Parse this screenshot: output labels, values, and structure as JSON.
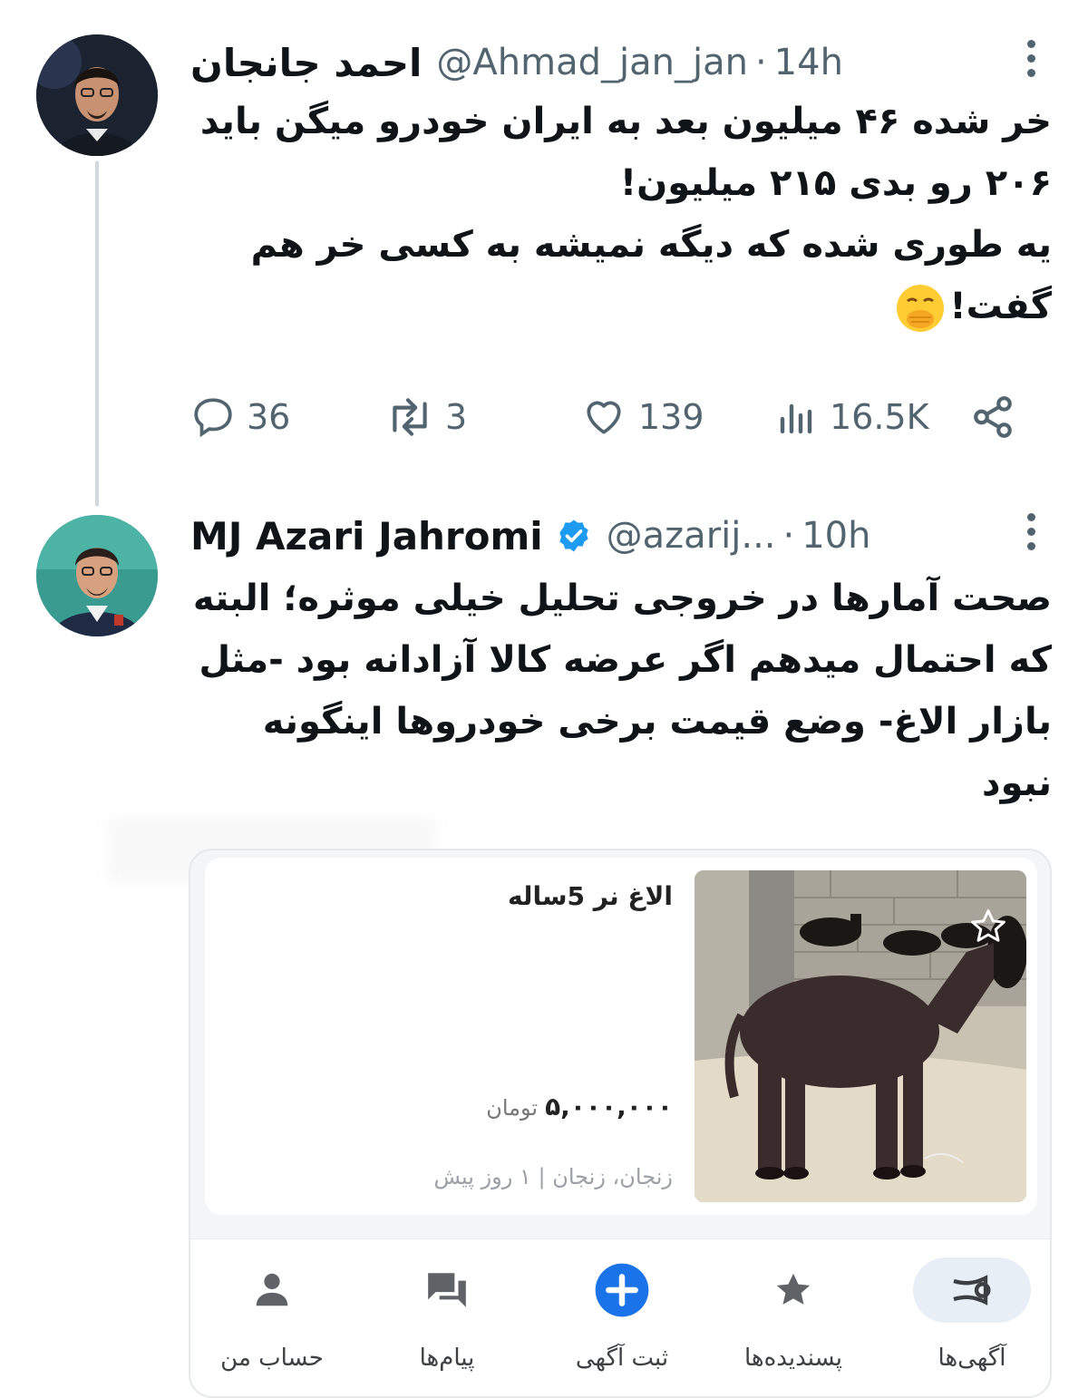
{
  "tweets": [
    {
      "name": "احمد جانجان",
      "handle": "@Ahmad_jan_jan",
      "separator": "·",
      "time": "14h",
      "body_lines": [
        "خر شده ۴۶ میلیون بعد به ایران خودرو میگن باید",
        "۲۰۶ رو بدی ۲۱۵ میلیون!",
        "یه طوری شده که دیگه نمیشه به کسی خر هم",
        "گفت!"
      ],
      "emoji": "face-with-hand-over-mouth",
      "stats": {
        "replies": "36",
        "retweets": "3",
        "likes": "139",
        "views": "16.5K"
      }
    },
    {
      "name": "MJ Azari Jahromi",
      "verified": true,
      "handle": "@azarij...",
      "separator": "·",
      "time": "10h",
      "body_lines": [
        "صحت آمارها در خروجی تحلیل خیلی موثره؛ البته",
        "که احتمال میدهم اگر عرضه کالا آزادانه بود -مثل",
        "بازار الاغ- وضع قیمت برخی خودروها اینگونه",
        "نبود"
      ]
    }
  ],
  "listing": {
    "title": "الاغ نر 5ساله",
    "price": "۵,۰۰۰,۰۰۰",
    "currency": "تومان",
    "location": "زنجان، زنجان | ۱ روز پیش"
  },
  "bottom_nav": [
    {
      "label": "آگهی‌ها",
      "icon": "horn-icon",
      "active": true
    },
    {
      "label": "پسندیده‌ها",
      "icon": "star-icon",
      "active": false
    },
    {
      "label": "ثبت آگهی",
      "icon": "add-circle-icon",
      "active": false
    },
    {
      "label": "پیام‌ها",
      "icon": "chat-icon",
      "active": false
    },
    {
      "label": "حساب من",
      "icon": "person-icon",
      "active": false
    }
  ],
  "colors": {
    "text": "#0f1419",
    "muted": "#536471",
    "verified_blue": "#1d9bf0",
    "thread_line": "#cfd9de",
    "nav_accent": "#1a73e8"
  }
}
